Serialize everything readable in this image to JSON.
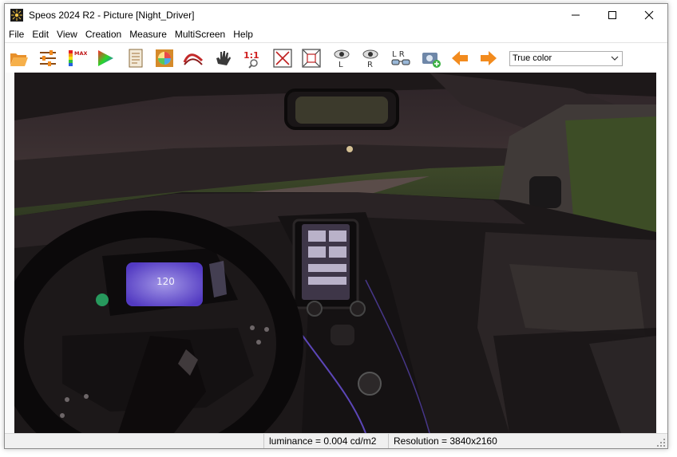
{
  "window": {
    "title": "Speos 2024 R2 - Picture [Night_Driver]",
    "controls": [
      "minimize-icon",
      "maximize-icon",
      "close-icon"
    ]
  },
  "menu": {
    "items": [
      "File",
      "Edit",
      "View",
      "Creation",
      "Measure",
      "MultiScreen",
      "Help"
    ]
  },
  "toolbar": {
    "buttons": [
      {
        "name": "open-folder-icon"
      },
      {
        "name": "settings-sliders-icon"
      },
      {
        "name": "false-color-max-icon",
        "label": "MAX"
      },
      {
        "name": "color-triangle-icon"
      },
      {
        "name": "document-report-icon"
      },
      {
        "name": "color-wheel-icon"
      },
      {
        "name": "spectrum-curve-icon"
      },
      {
        "name": "hand-pan-icon"
      },
      {
        "name": "zoom-1-to-1-icon",
        "label": "1:1"
      },
      {
        "name": "fit-to-window-icon"
      },
      {
        "name": "fit-in-icon"
      },
      {
        "name": "eye-left-icon",
        "label": "L"
      },
      {
        "name": "eye-right-icon",
        "label": "R"
      },
      {
        "name": "stereo-glasses-icon",
        "label": "L R"
      },
      {
        "name": "camera-add-icon"
      },
      {
        "name": "arrow-left-icon"
      },
      {
        "name": "arrow-right-icon"
      }
    ],
    "color_mode": {
      "value": "True color"
    }
  },
  "status": {
    "luminance": "luminance = 0.004 cd/m2",
    "resolution": "Resolution = 3840x2160"
  },
  "colors": {
    "accent_orange": "#f28b1e",
    "dashboard_screen": "#8c73ff",
    "ambient_purple": "#7a5cff"
  }
}
